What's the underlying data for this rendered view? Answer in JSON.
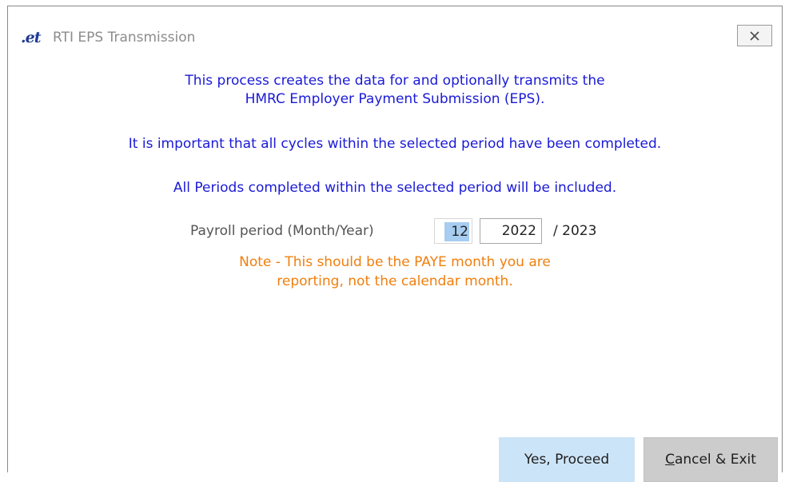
{
  "window": {
    "title": "RTI EPS Transmission",
    "logo_text": "et",
    "close_label": "close"
  },
  "info": {
    "line1": "This process creates the data for and optionally transmits the",
    "line2": "HMRC Employer Payment Submission (EPS).",
    "line3": "It is important that all cycles within the selected period have been completed.",
    "line4": "All Periods completed within the selected period will be included."
  },
  "period": {
    "label": "Payroll period (Month/Year)",
    "month_value": "12",
    "year_value": "2022",
    "year_suffix": "/ 2023"
  },
  "note": {
    "line1": "Note - This should be the PAYE month you are",
    "line2": "reporting, not the calendar month."
  },
  "buttons": {
    "proceed_label": "Yes, Proceed",
    "cancel_first_letter": "C",
    "cancel_rest": "ancel & Exit"
  },
  "colors": {
    "info_text": "#1a1ad6",
    "note_text": "#f07f0e",
    "proceed_bg": "#cce4f7",
    "cancel_bg": "#cccccc",
    "selection": "#a7cdf0"
  }
}
